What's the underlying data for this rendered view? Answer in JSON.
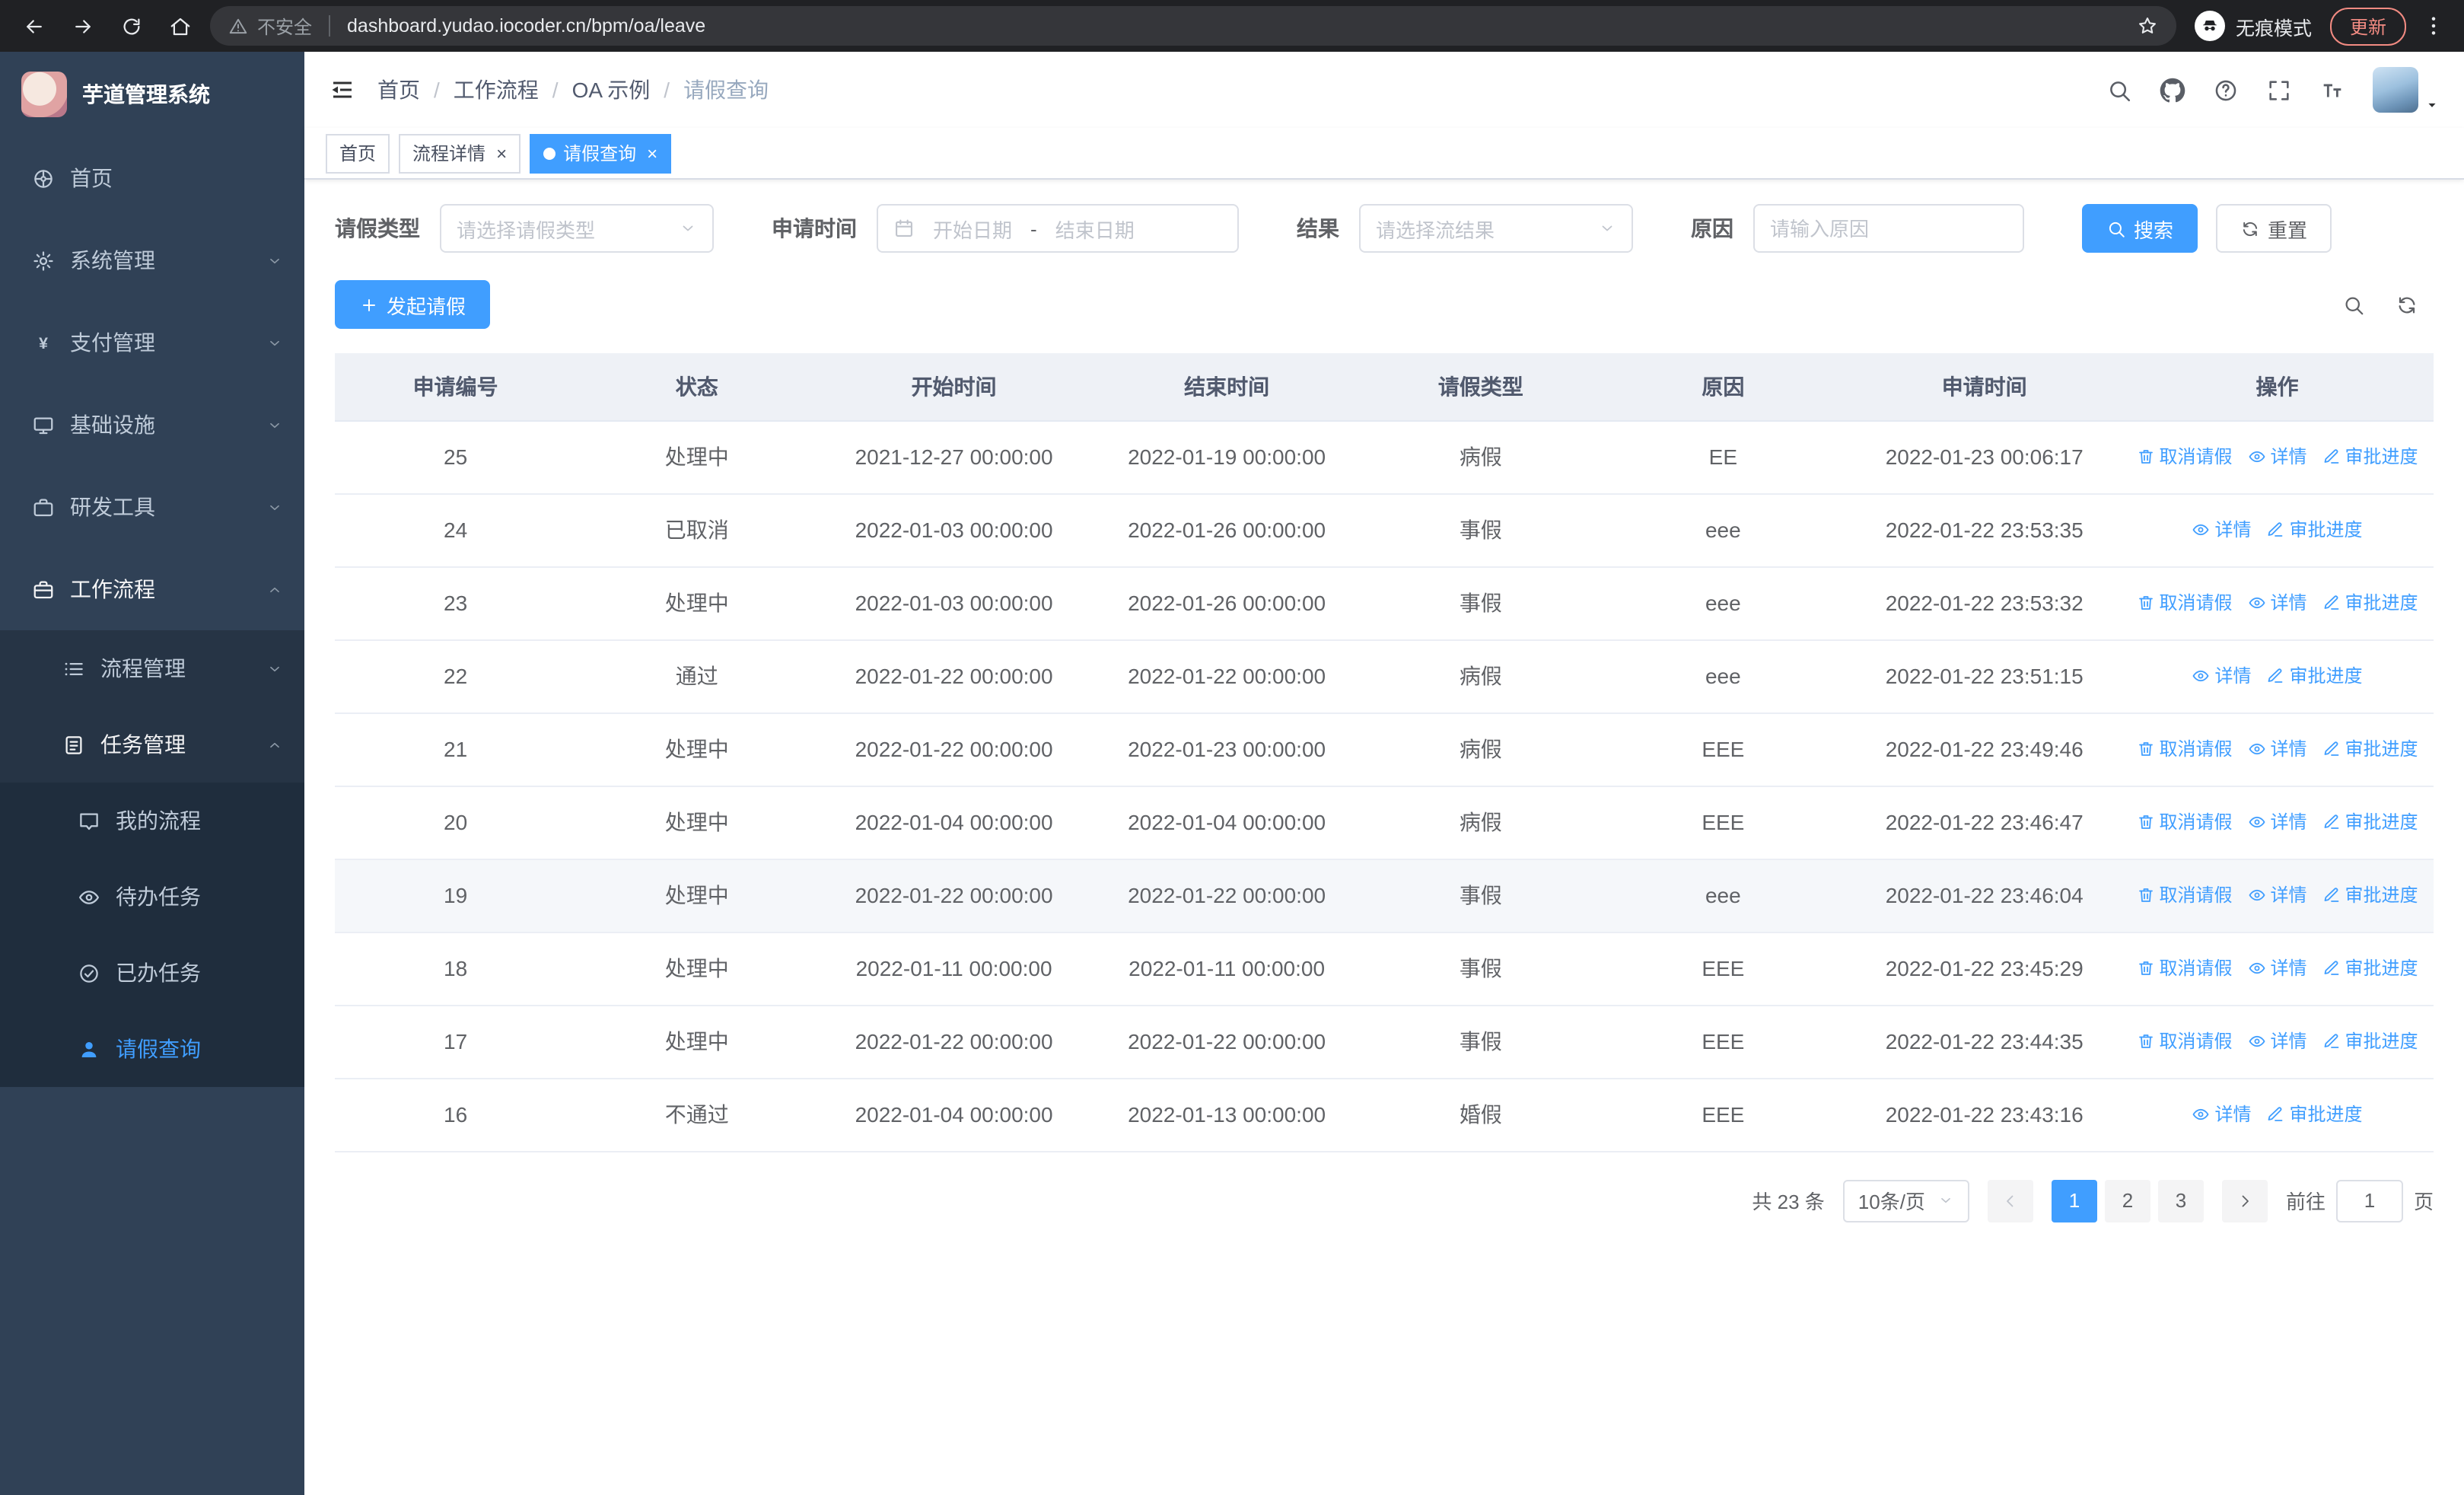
{
  "browser": {
    "nav_icons": [
      "arrow-left",
      "arrow-right",
      "reload",
      "home"
    ],
    "security_label": "不安全",
    "url": "dashboard.yudao.iocoder.cn/bpm/oa/leave",
    "incognito_label": "无痕模式",
    "update_label": "更新"
  },
  "sidebar": {
    "logo_title": "芋道管理系统",
    "menu": [
      {
        "label": "首页",
        "icon": "dashboard",
        "level": 1
      },
      {
        "label": "系统管理",
        "icon": "gear",
        "level": 1,
        "arrow": "down"
      },
      {
        "label": "支付管理",
        "icon": "yen",
        "level": 1,
        "arrow": "down"
      },
      {
        "label": "基础设施",
        "icon": "monitor",
        "level": 1,
        "arrow": "down"
      },
      {
        "label": "研发工具",
        "icon": "tool",
        "level": 1,
        "arrow": "down"
      },
      {
        "label": "工作流程",
        "icon": "briefcase",
        "level": 1,
        "arrow": "up",
        "expanded": true
      },
      {
        "label": "流程管理",
        "icon": "list",
        "level": 2,
        "arrow": "down"
      },
      {
        "label": "任务管理",
        "icon": "tasks",
        "level": 2,
        "arrow": "up",
        "expanded": true
      },
      {
        "label": "我的流程",
        "icon": "message",
        "level": 3
      },
      {
        "label": "待办任务",
        "icon": "eye",
        "level": 3
      },
      {
        "label": "已办任务",
        "icon": "finished",
        "level": 3
      },
      {
        "label": "请假查询",
        "icon": "user",
        "level": 3,
        "active": true
      }
    ]
  },
  "header": {
    "breadcrumb": [
      {
        "label": "首页"
      },
      {
        "label": "工作流程"
      },
      {
        "label": "OA 示例"
      },
      {
        "label": "请假查询",
        "current": true
      }
    ],
    "tools": [
      "search",
      "github",
      "help",
      "fullscreen",
      "font-size",
      "avatar"
    ]
  },
  "tabs": [
    {
      "label": "首页",
      "active": false,
      "closable": false,
      "dot": false
    },
    {
      "label": "流程详情",
      "active": false,
      "closable": true,
      "dot": false
    },
    {
      "label": "请假查询",
      "active": true,
      "closable": true,
      "dot": true
    }
  ],
  "filters": {
    "leave_type": {
      "label": "请假类型",
      "placeholder": "请选择请假类型"
    },
    "apply_time": {
      "label": "申请时间",
      "start_placeholder": "开始日期",
      "separator": "-",
      "end_placeholder": "结束日期"
    },
    "result": {
      "label": "结果",
      "placeholder": "请选择流结果"
    },
    "reason": {
      "label": "原因",
      "placeholder": "请输入原因"
    },
    "search_button": "搜索",
    "reset_button": "重置"
  },
  "toolbar": {
    "create_button": "发起请假"
  },
  "table": {
    "columns": [
      "申请编号",
      "状态",
      "开始时间",
      "结束时间",
      "请假类型",
      "原因",
      "申请时间",
      "操作"
    ],
    "rows": [
      {
        "id": "25",
        "status": "处理中",
        "start": "2021-12-27 00:00:00",
        "end": "2022-01-19 00:00:00",
        "type": "病假",
        "reason": "EE",
        "applied": "2022-01-23 00:06:17",
        "actions": [
          "取消请假",
          "详情",
          "审批进度"
        ]
      },
      {
        "id": "24",
        "status": "已取消",
        "start": "2022-01-03 00:00:00",
        "end": "2022-01-26 00:00:00",
        "type": "事假",
        "reason": "eee",
        "applied": "2022-01-22 23:53:35",
        "actions": [
          "详情",
          "审批进度"
        ]
      },
      {
        "id": "23",
        "status": "处理中",
        "start": "2022-01-03 00:00:00",
        "end": "2022-01-26 00:00:00",
        "type": "事假",
        "reason": "eee",
        "applied": "2022-01-22 23:53:32",
        "actions": [
          "取消请假",
          "详情",
          "审批进度"
        ]
      },
      {
        "id": "22",
        "status": "通过",
        "start": "2022-01-22 00:00:00",
        "end": "2022-01-22 00:00:00",
        "type": "病假",
        "reason": "eee",
        "applied": "2022-01-22 23:51:15",
        "actions": [
          "详情",
          "审批进度"
        ]
      },
      {
        "id": "21",
        "status": "处理中",
        "start": "2022-01-22 00:00:00",
        "end": "2022-01-23 00:00:00",
        "type": "病假",
        "reason": "EEE",
        "applied": "2022-01-22 23:49:46",
        "actions": [
          "取消请假",
          "详情",
          "审批进度"
        ]
      },
      {
        "id": "20",
        "status": "处理中",
        "start": "2022-01-04 00:00:00",
        "end": "2022-01-04 00:00:00",
        "type": "病假",
        "reason": "EEE",
        "applied": "2022-01-22 23:46:47",
        "actions": [
          "取消请假",
          "详情",
          "审批进度"
        ]
      },
      {
        "id": "19",
        "status": "处理中",
        "start": "2022-01-22 00:00:00",
        "end": "2022-01-22 00:00:00",
        "type": "事假",
        "reason": "eee",
        "applied": "2022-01-22 23:46:04",
        "actions": [
          "取消请假",
          "详情",
          "审批进度"
        ],
        "hover": true
      },
      {
        "id": "18",
        "status": "处理中",
        "start": "2022-01-11 00:00:00",
        "end": "2022-01-11 00:00:00",
        "type": "事假",
        "reason": "EEE",
        "applied": "2022-01-22 23:45:29",
        "actions": [
          "取消请假",
          "详情",
          "审批进度"
        ]
      },
      {
        "id": "17",
        "status": "处理中",
        "start": "2022-01-22 00:00:00",
        "end": "2022-01-22 00:00:00",
        "type": "事假",
        "reason": "EEE",
        "applied": "2022-01-22 23:44:35",
        "actions": [
          "取消请假",
          "详情",
          "审批进度"
        ]
      },
      {
        "id": "16",
        "status": "不通过",
        "start": "2022-01-04 00:00:00",
        "end": "2022-01-13 00:00:00",
        "type": "婚假",
        "reason": "EEE",
        "applied": "2022-01-22 23:43:16",
        "actions": [
          "详情",
          "审批进度"
        ]
      }
    ]
  },
  "pagination": {
    "total_label": "共 23 条",
    "page_size_label": "10条/页",
    "pages": [
      "1",
      "2",
      "3"
    ],
    "active_page": "1",
    "goto_prefix": "前往",
    "goto_value": "1",
    "goto_suffix": "页"
  },
  "colors": {
    "primary": "#409eff",
    "sidebar_bg": "#304156",
    "sidebar_submenu_bg": "#1f2d3d",
    "chrome_bg": "#202124",
    "update_accent": "#f28b82",
    "table_header_bg": "#eef1f6"
  }
}
